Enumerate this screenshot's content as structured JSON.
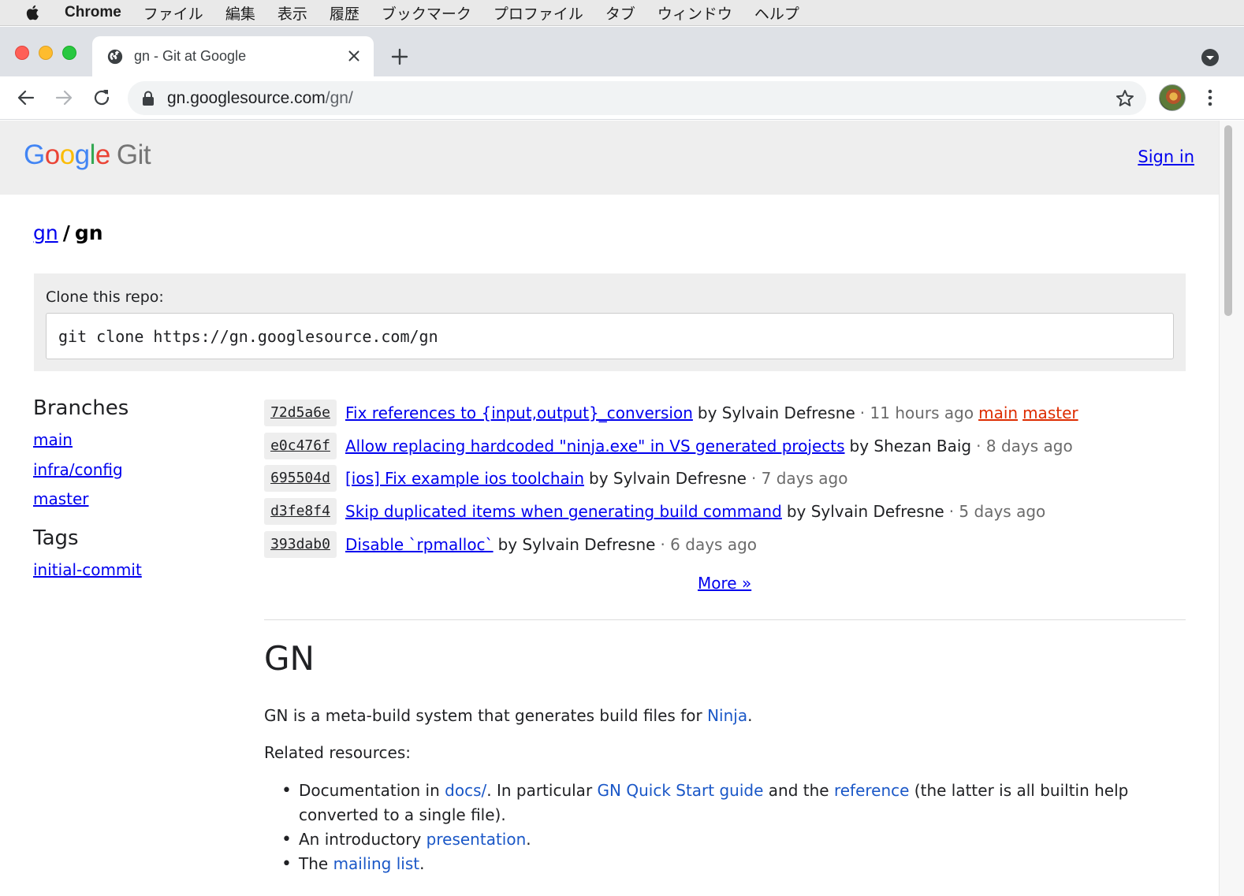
{
  "menubar": {
    "app": "Chrome",
    "items": [
      "ファイル",
      "編集",
      "表示",
      "履歴",
      "ブックマーク",
      "プロファイル",
      "タブ",
      "ウィンドウ",
      "ヘルプ"
    ]
  },
  "tab": {
    "title": "gn - Git at Google"
  },
  "address": {
    "host": "gn.googlesource.com",
    "path": "/gn/"
  },
  "header": {
    "logo_letters": [
      "G",
      "o",
      "o",
      "g",
      "l",
      "e"
    ],
    "logo_suffix": "Git",
    "signin": "Sign in"
  },
  "breadcrumb": {
    "parent": "gn",
    "separator": "/",
    "current": "gn"
  },
  "clone": {
    "label": "Clone this repo:",
    "command": "git clone https://gn.googlesource.com/gn"
  },
  "sidebar": {
    "branches_title": "Branches",
    "branches": [
      "main",
      "infra/config",
      "master"
    ],
    "tags_title": "Tags",
    "tags": [
      "initial-commit"
    ]
  },
  "commits": [
    {
      "sha": "72d5a6e",
      "message": "Fix references to {input,output}_conversion",
      "by": "by Sylvain Defresne",
      "ago": "· 11 hours ago",
      "refs": [
        "main",
        "master"
      ]
    },
    {
      "sha": "e0c476f",
      "message": "Allow replacing hardcoded \"ninja.exe\" in VS generated projects",
      "by": "by Shezan Baig",
      "ago": "· 8 days ago",
      "refs": []
    },
    {
      "sha": "695504d",
      "message": "[ios] Fix example ios toolchain",
      "by": "by Sylvain Defresne",
      "ago": "· 7 days ago",
      "refs": []
    },
    {
      "sha": "d3fe8f4",
      "message": "Skip duplicated items when generating build command",
      "by": "by Sylvain Defresne",
      "ago": "· 5 days ago",
      "refs": []
    },
    {
      "sha": "393dab0",
      "message": "Disable `rpmalloc`",
      "by": "by Sylvain Defresne",
      "ago": "· 6 days ago",
      "refs": []
    }
  ],
  "more": "More »",
  "readme": {
    "title": "GN",
    "intro_pre": "GN is a meta-build system that generates build files for ",
    "intro_link": "Ninja",
    "intro_post": ".",
    "related": "Related resources:",
    "item1_a": "Documentation in ",
    "item1_link1": "docs/",
    "item1_b": ". In particular ",
    "item1_link2": "GN Quick Start guide",
    "item1_c": " and the ",
    "item1_link3": "reference",
    "item1_d": " (the latter is all builtin help converted to a single file).",
    "item2_a": "An introductory ",
    "item2_link": "presentation",
    "item2_b": ".",
    "item3_a": "The ",
    "item3_link": "mailing list",
    "item3_b": "."
  },
  "icons": {
    "apple": "apple-icon",
    "globe": "globe-icon",
    "close": "close-icon",
    "plus": "plus-icon",
    "back": "back-arrow-icon",
    "forward": "forward-arrow-icon",
    "reload": "reload-icon",
    "lock": "lock-icon",
    "star": "star-icon",
    "kebab": "more-vert-icon"
  },
  "colors": {
    "link": "#0000ee",
    "readme_link": "#1a57c7",
    "ref": "#dd2c00",
    "header_bg": "#eeeeee"
  }
}
